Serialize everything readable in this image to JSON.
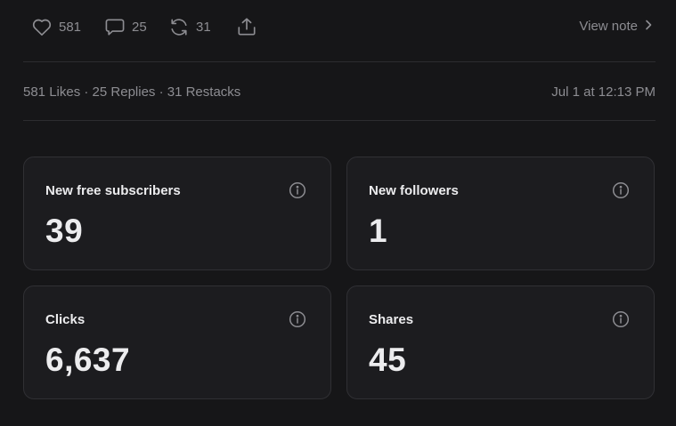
{
  "actions": {
    "like_count": "581",
    "reply_count": "25",
    "restack_count": "31",
    "view_note_label": "View note"
  },
  "meta": {
    "stats": "581 Likes · 25 Replies · 31 Restacks",
    "date": "Jul 1 at 12:13 PM"
  },
  "cards": [
    {
      "label": "New free subscribers",
      "value": "39"
    },
    {
      "label": "New followers",
      "value": "1"
    },
    {
      "label": "Clicks",
      "value": "6,637"
    },
    {
      "label": "Shares",
      "value": "45"
    }
  ],
  "colors": {
    "background": "#161618",
    "card": "#1c1c1f",
    "muted_text": "#8d8d92",
    "primary_text": "#ececee"
  },
  "icons": [
    "heart-icon",
    "comment-icon",
    "restack-icon",
    "share-icon",
    "chevron-right-icon",
    "info-icon"
  ]
}
